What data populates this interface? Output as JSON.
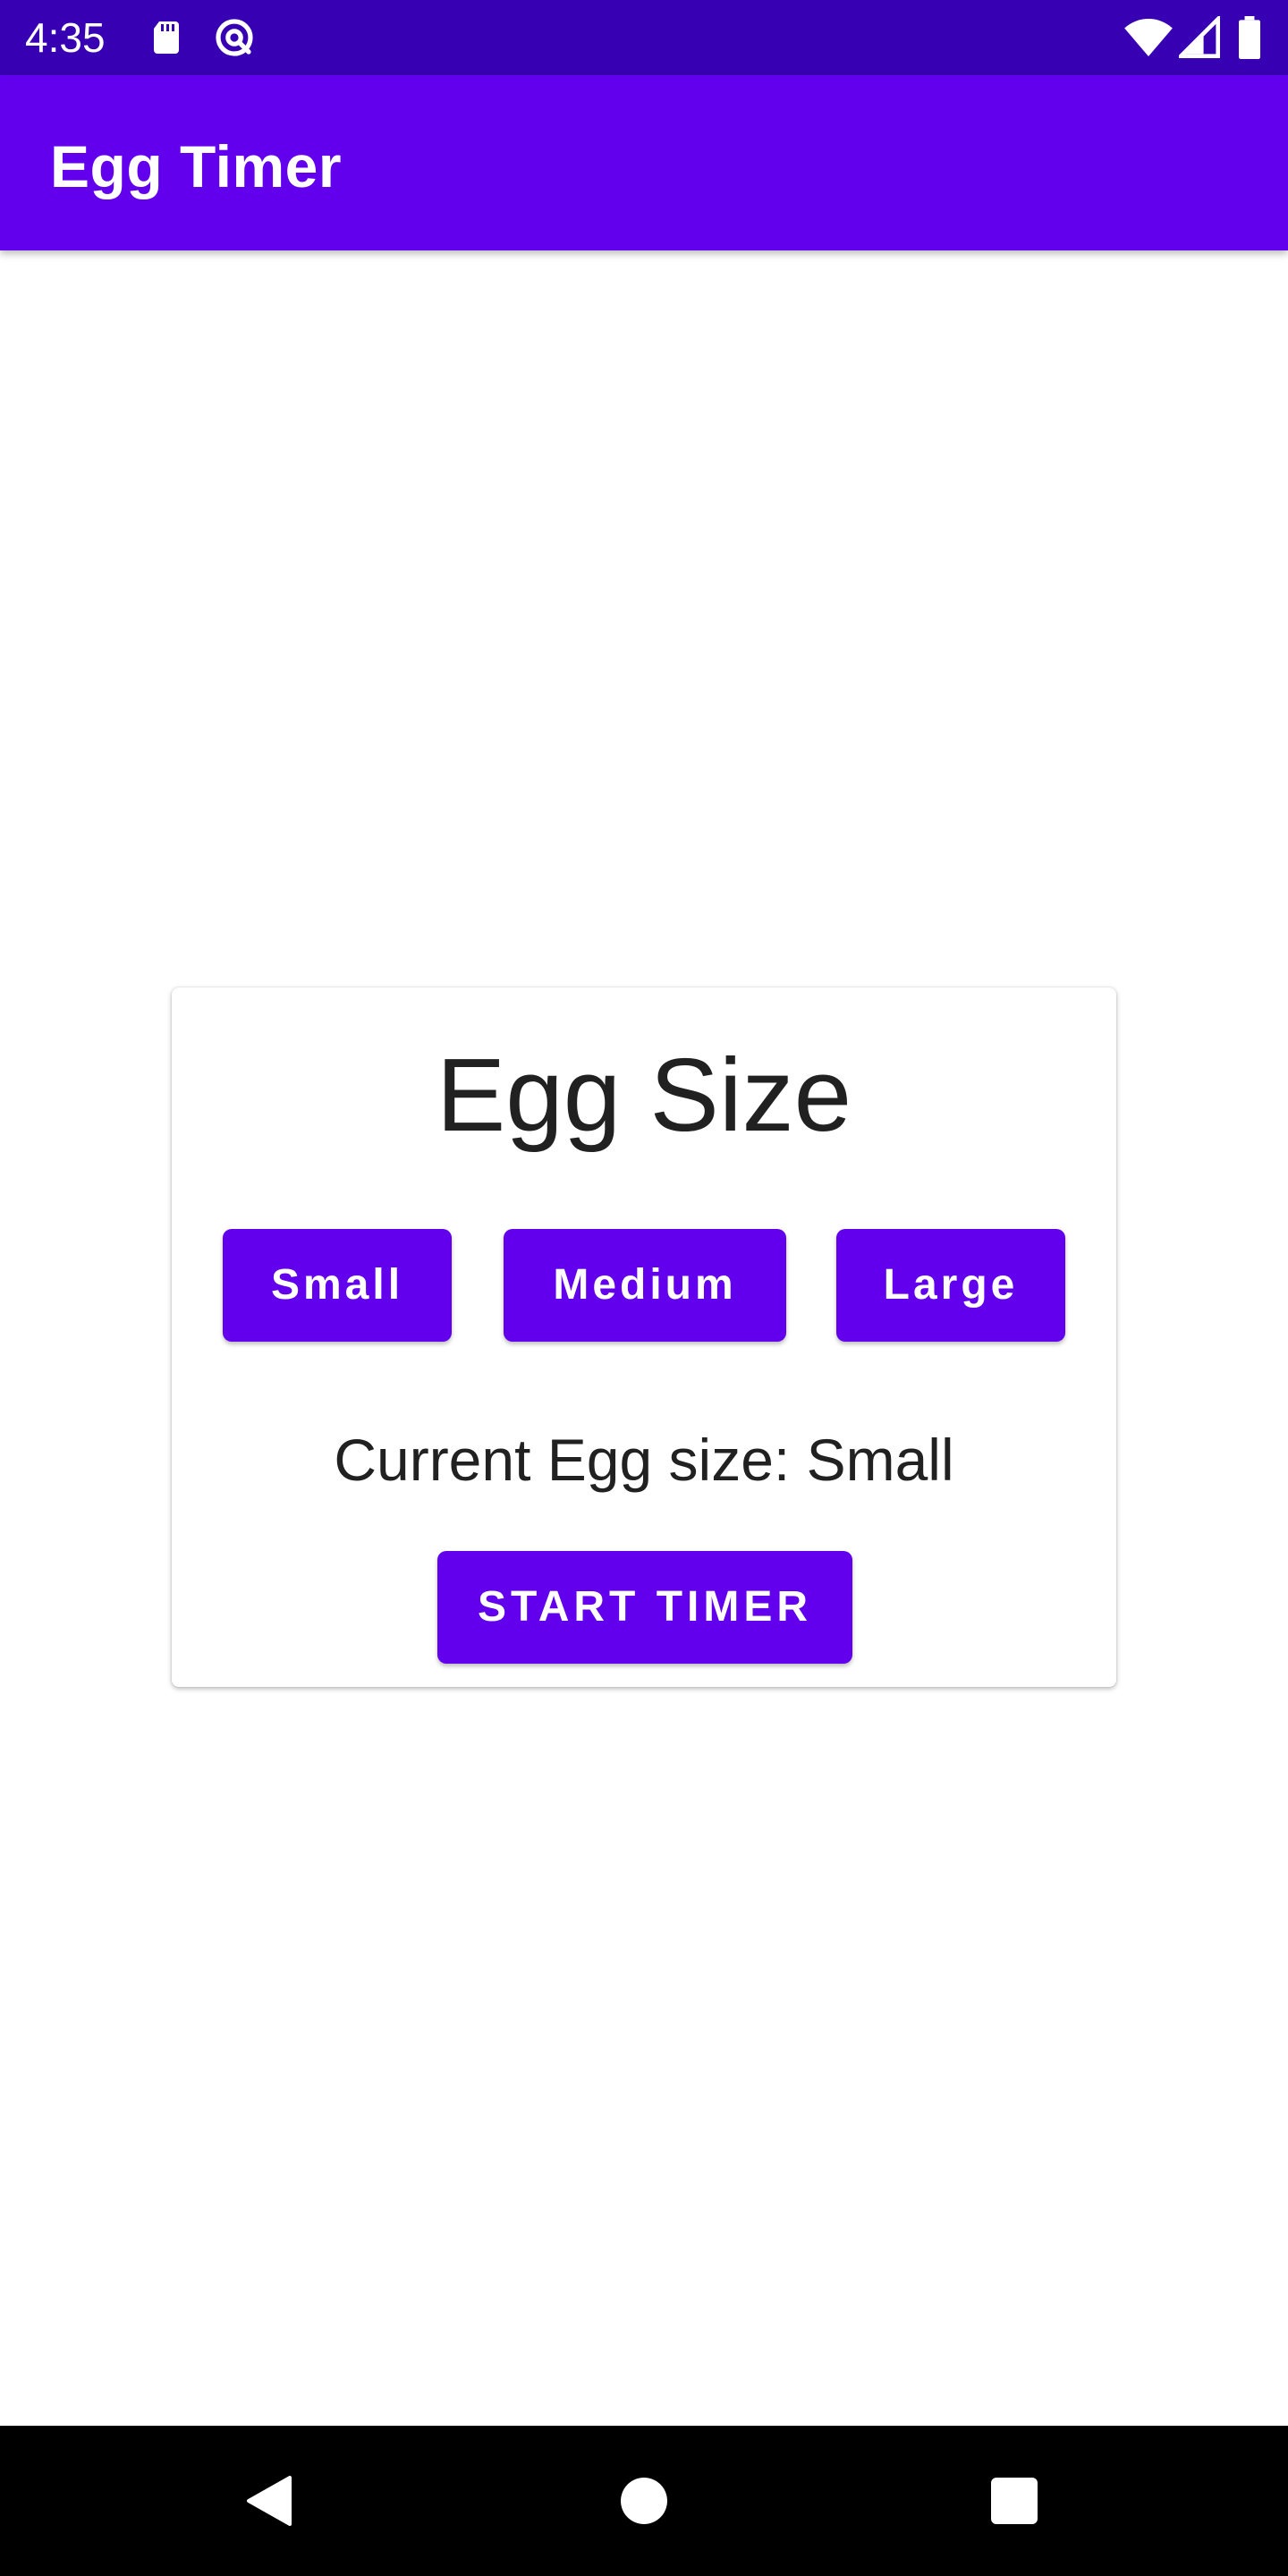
{
  "status_bar": {
    "time": "4:35",
    "icons_left": [
      "sd-card-icon",
      "at-sign-icon"
    ],
    "icons_right": [
      "wifi-icon",
      "cell-signal-icon",
      "battery-icon"
    ]
  },
  "app_bar": {
    "title": "Egg Timer"
  },
  "card": {
    "title": "Egg Size",
    "size_buttons": [
      {
        "label": "Small"
      },
      {
        "label": "Medium"
      },
      {
        "label": "Large"
      }
    ],
    "current_size_text": "Current Egg size: Small",
    "start_button_label": "START TIMER"
  },
  "nav_bar": {
    "buttons": [
      "back-icon",
      "home-icon",
      "recents-icon"
    ]
  },
  "colors": {
    "status_bar": "#3700b3",
    "primary": "#6200ee",
    "text": "#212121",
    "background": "#ffffff",
    "nav_bar": "#000000"
  }
}
